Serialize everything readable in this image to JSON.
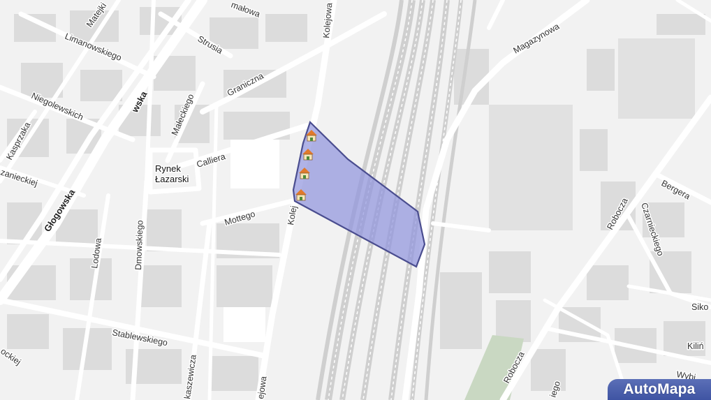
{
  "brand": {
    "label": "AutoMapa",
    "color": "#5b6fb7"
  },
  "place": {
    "line1": "Rynek",
    "line2": "Łazarski"
  },
  "area": {
    "fill": "#8f93dd",
    "stroke": "#4a4d8f",
    "marker_icon": "house-icon"
  },
  "streets": {
    "glogowska_top": "wska",
    "glogowska": "Głogowska",
    "matejki": "Matejki",
    "limanowskiego": "Limanowskiego",
    "strusia": "Strusia",
    "graniczna": "Graniczna",
    "kolejowa_top": "Kolejowa",
    "malowa": "małowa",
    "niegolewskich": "Niegolewskich",
    "kasprzaka": "Kasprzaka",
    "maleckiego": "Małeckiego",
    "calliera": "Calliera",
    "zaniecki": "zanieckiej",
    "mottego": "Mottego",
    "kolej_mid": "Kolej",
    "dmowskiego": "Dmowskiego",
    "lodowa": "Lodowa",
    "stablewskiego": "Stablewskiego",
    "kaszewicza": "kaszewicza",
    "kolejowa_bottom": "ejowa",
    "ockiej": "ockiej",
    "magazynowa": "Magazynowa",
    "bergera": "Bergera",
    "czarnieckiego": "Czarnieckiego",
    "robocza_upper": "Robocza",
    "robocza_lower": "Robocza",
    "siko": "Siko",
    "kilins": "Kiliń",
    "wybicki": "Wybi",
    "iego": "iego"
  }
}
